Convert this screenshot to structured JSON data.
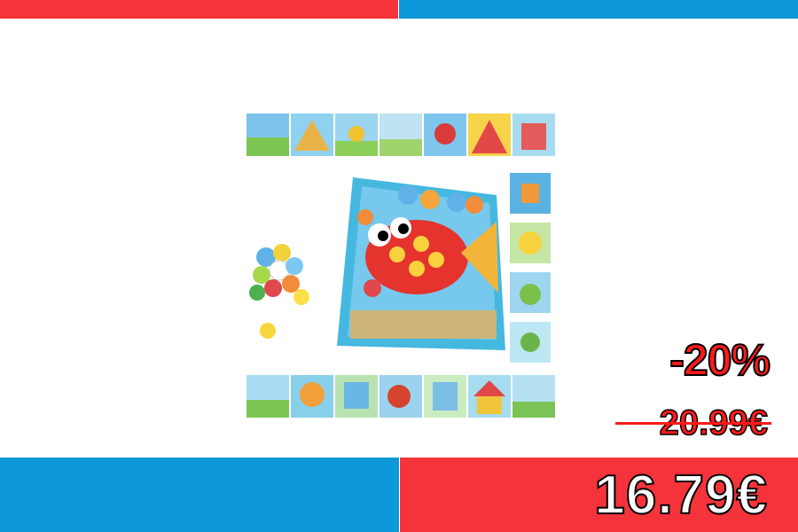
{
  "colors": {
    "red": "#f5333a",
    "blue": "#0d98d9",
    "discount_red": "#ff1a1a",
    "text_white": "#ffffff"
  },
  "price": {
    "discount": "-20%",
    "old_price": "20.99€",
    "new_price": "16.79€"
  },
  "product_image": {
    "icon": "button-art-puzzle-toy-image"
  }
}
